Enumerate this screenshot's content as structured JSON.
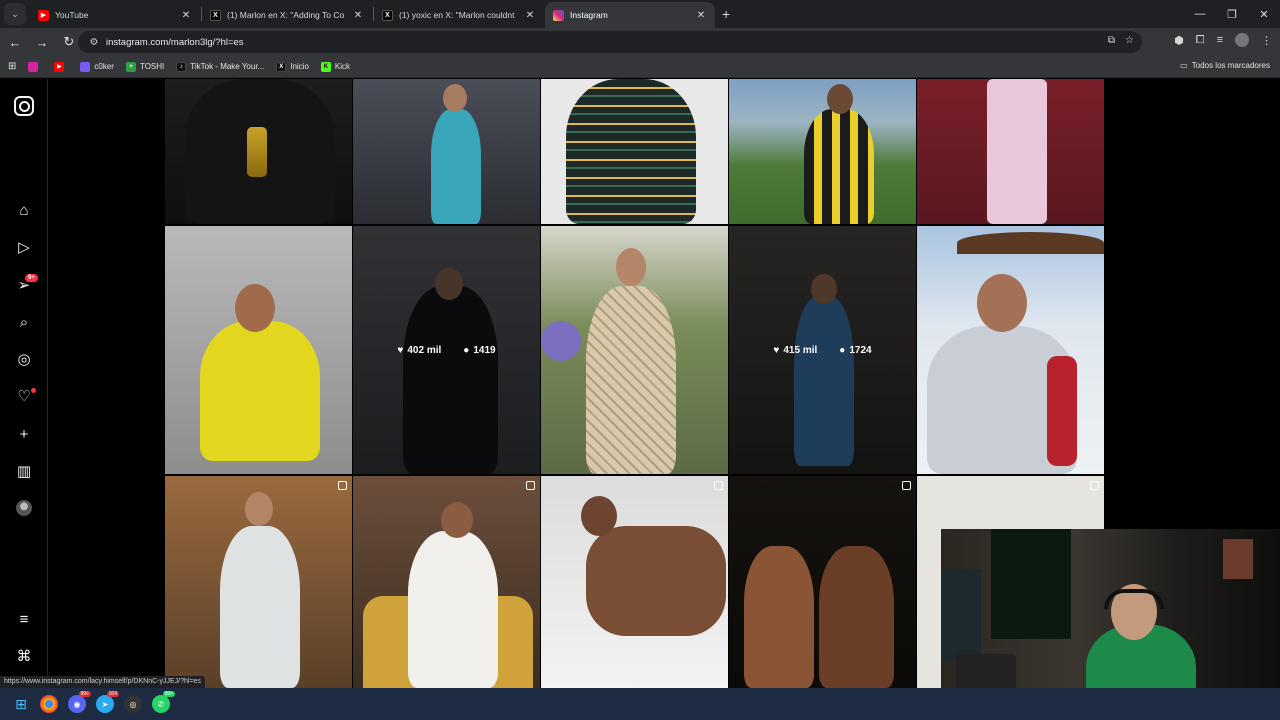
{
  "browser": {
    "tabs": [
      {
        "title": "YouTube",
        "favicon": "youtube-icon",
        "active": false
      },
      {
        "title": "(1) Marlon en X: \"Adding To Co",
        "favicon": "x-icon",
        "active": false
      },
      {
        "title": "(1) yoxic en X: \"Marlon couldnt",
        "favicon": "x-icon",
        "active": false
      },
      {
        "title": "Instagram",
        "favicon": "instagram-icon",
        "active": true
      }
    ],
    "url": "instagram.com/marlon3lg/?hl=es",
    "bookmarks": [
      {
        "label": "",
        "icon": "instagram-icon",
        "color": "#d6249f"
      },
      {
        "label": "",
        "icon": "youtube-icon",
        "color": "#ff0000"
      },
      {
        "label": "c0ker",
        "icon": "bookmark-icon",
        "color": "#7a5af8"
      },
      {
        "label": "TOSHI",
        "icon": "plus-icon",
        "color": "#2f9e44"
      },
      {
        "label": "TikTok - Make Your...",
        "icon": "tiktok-icon",
        "color": "#111111"
      },
      {
        "label": "Inicio",
        "icon": "x-icon",
        "color": "#111111"
      },
      {
        "label": "Kick",
        "icon": "kick-icon",
        "color": "#53fc18"
      }
    ],
    "all_bookmarks": "Todos los marcadores",
    "status_url": "https://www.instagram.com/lacy.himself/p/DKNnC-yJJEJ/?hl=es"
  },
  "instagram": {
    "nav_badge": "9+",
    "posts": [
      {
        "row": 0,
        "col": 0,
        "likes": "",
        "comments": ""
      },
      {
        "row": 1,
        "col": 1,
        "likes": "402 mil",
        "comments": "1419"
      },
      {
        "row": 1,
        "col": 3,
        "likes": "415 mil",
        "comments": "1724"
      }
    ]
  },
  "taskbar": {
    "badges": [
      "99+",
      "104",
      "",
      "99+"
    ]
  }
}
